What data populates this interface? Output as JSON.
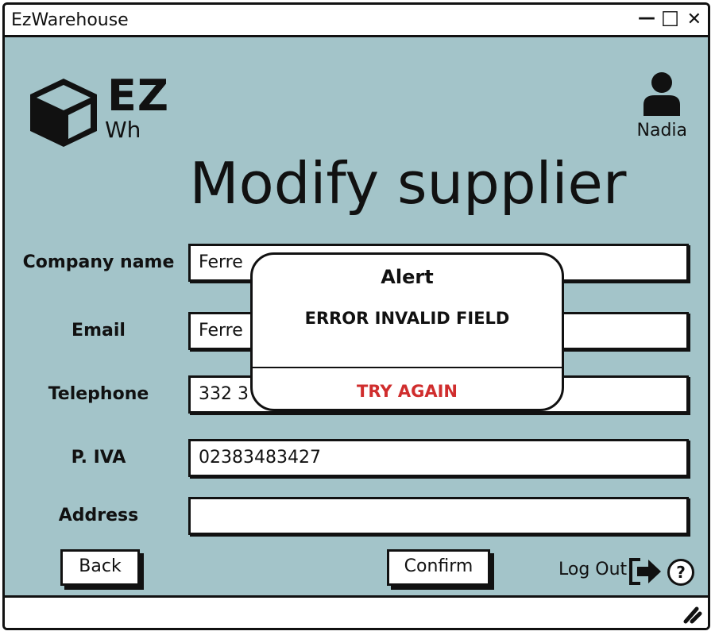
{
  "window": {
    "title": "EzWarehouse",
    "controls": {
      "minimize": "—",
      "maximize": "☐",
      "close": "✕"
    }
  },
  "logo": {
    "big": "EZ",
    "small": "Wh",
    "icon": "box-icon"
  },
  "user": {
    "name": "Nadia",
    "icon": "user-icon"
  },
  "page_title": "Modify supplier",
  "form": {
    "company_name": {
      "label": "Company name",
      "value": "Ferre"
    },
    "email": {
      "label": "Email",
      "value": "Ferre"
    },
    "telephone": {
      "label": "Telephone",
      "value": "332 3"
    },
    "piva": {
      "label": "P. IVA",
      "value": "02383483427"
    },
    "address": {
      "label": "Address",
      "value": ""
    }
  },
  "buttons": {
    "back": "Back",
    "confirm": "Confirm"
  },
  "footer": {
    "logout": "Log Out",
    "logout_icon": "logout-arrow-icon",
    "help_icon": "help-icon",
    "help_glyph": "?"
  },
  "alert": {
    "title": "Alert",
    "message": "ERROR INVALID FIELD",
    "action": "TRY AGAIN"
  },
  "colors": {
    "content_bg": "#a3c4c9",
    "alert_action": "#d02d2d",
    "border": "#111111"
  }
}
